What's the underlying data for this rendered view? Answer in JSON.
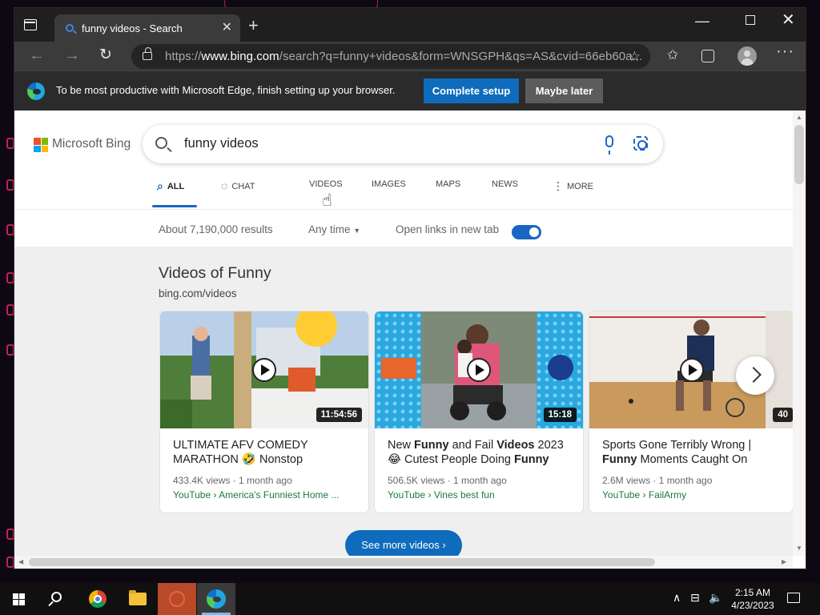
{
  "browser": {
    "tab_title": "funny videos - Search",
    "url_prefix": "https://",
    "url_host": "www.bing.com",
    "url_rest": "/search?q=funny+videos&form=WNSGPH&qs=AS&cvid=66eb60a..."
  },
  "infobar": {
    "message": "To be most productive with Microsoft Edge, finish setting up your browser.",
    "primary_label": "Complete setup",
    "secondary_label": "Maybe later"
  },
  "bing": {
    "logo_text": "Microsoft Bing",
    "query": "funny videos",
    "nav": [
      {
        "label": "ALL",
        "icon": "search-icon"
      },
      {
        "label": "CHAT",
        "icon": "chat-icon"
      },
      {
        "label": "VIDEOS"
      },
      {
        "label": "IMAGES"
      },
      {
        "label": "MAPS"
      },
      {
        "label": "NEWS"
      },
      {
        "label": "MORE",
        "icon": "more-vertical-icon"
      }
    ],
    "results_count": "About 7,190,000 results",
    "time_filter": "Any time",
    "new_tab_label": "Open links in new tab",
    "new_tab_enabled": true,
    "section_title": "Videos of Funny",
    "section_source": "bing.com/videos",
    "videos": [
      {
        "title_html": "ULTIMATE AFV COMEDY MARATHON 🤣 Nonstop",
        "duration": "11:54:56",
        "meta": "433.4K views · 1 month ago",
        "source": "YouTube › America's Funniest Home ..."
      },
      {
        "title_html": "New <b>Funny</b> and Fail <b>Videos</b> 2023 😂 Cutest People Doing <b>Funny</b>",
        "duration": "15:18",
        "meta": "506.5K views · 1 month ago",
        "source": "YouTube › Vines best fun"
      },
      {
        "title_html": "Sports Gone Terribly Wrong | <b>Funny</b> Moments Caught On",
        "duration": "40",
        "meta": "2.6M views · 1 month ago",
        "source": "YouTube › FailArmy"
      }
    ],
    "see_more_label": "See more videos"
  },
  "taskbar": {
    "time": "2:15 AM",
    "date": "4/23/2023"
  },
  "colors": {
    "accent": "#0f6cbd",
    "link_green": "#1d7a3d"
  }
}
